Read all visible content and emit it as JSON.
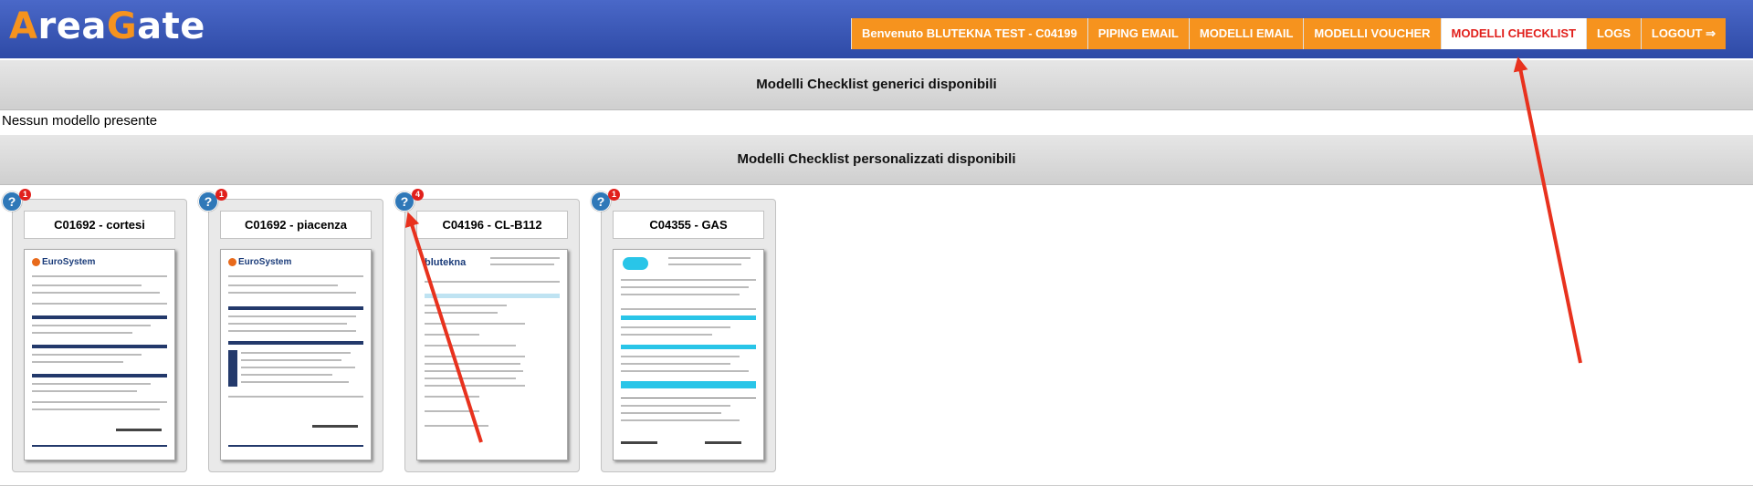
{
  "logo": {
    "part1": "A",
    "part2": "rea",
    "part3": "G",
    "part4": "ate"
  },
  "nav": {
    "welcome": "Benvenuto BLUTEKNA TEST - C04199",
    "piping_email": "PIPING EMAIL",
    "modelli_email": "MODELLI EMAIL",
    "modelli_voucher": "MODELLI VOUCHER",
    "modelli_checklist": "MODELLI CHECKLIST",
    "logs": "LOGS",
    "logout": "LOGOUT ⇒"
  },
  "generic_section": {
    "title": "Modelli Checklist generici disponibili",
    "empty_text": "Nessun modello presente"
  },
  "custom_section": {
    "title": "Modelli Checklist personalizzati disponibili"
  },
  "cards": [
    {
      "title": "C01692 - cortesi",
      "badge": "1",
      "help": "?"
    },
    {
      "title": "C01692 - piacenza",
      "badge": "1",
      "help": "?"
    },
    {
      "title": "C04196 - CL-B112",
      "badge": "4",
      "help": "?"
    },
    {
      "title": "C04355 - GAS",
      "badge": "1",
      "help": "?"
    }
  ],
  "thumb_text": {
    "eurosystem": "EuroSystem",
    "blutekna": "blutekna"
  },
  "colors": {
    "header": "#3a58b8",
    "nav": "#f6931e",
    "active": "#e1201c",
    "annotation_arrow": "#e8321e"
  }
}
